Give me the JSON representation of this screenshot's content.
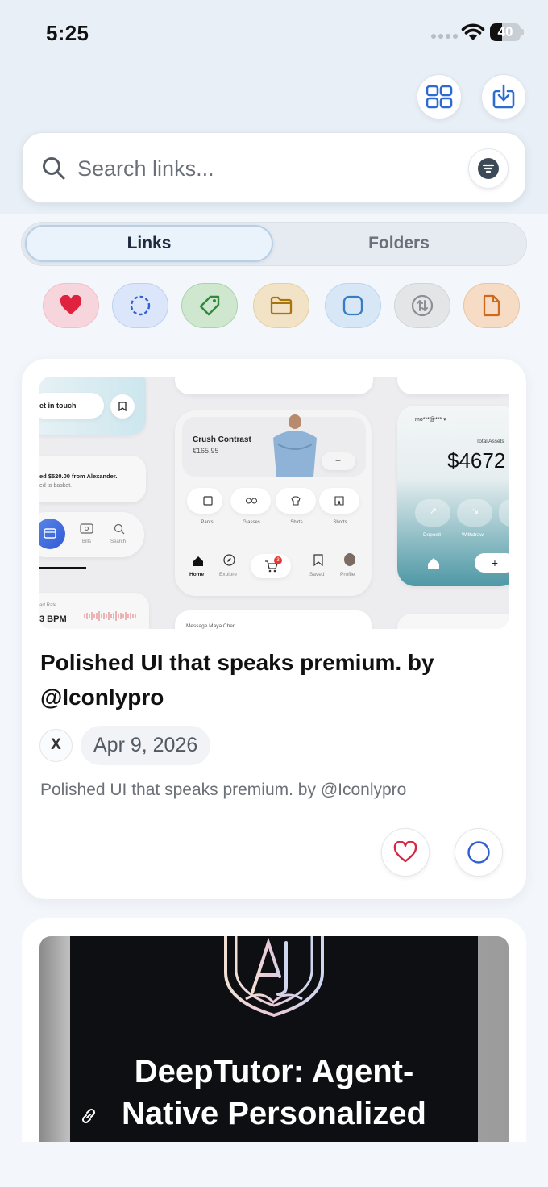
{
  "status_bar": {
    "time": "5:25",
    "battery_level": "40"
  },
  "toolbar": {
    "grid_icon": "grid-icon",
    "import_icon": "download-tray-icon"
  },
  "search": {
    "placeholder": "Search links...",
    "filter_icon": "filter-lines-icon"
  },
  "tabs": [
    {
      "label": "Links",
      "active": true
    },
    {
      "label": "Folders",
      "active": false
    }
  ],
  "filter_chips": [
    {
      "icon": "heart-icon",
      "color": "#f7d5dc",
      "accent": "#e0223f"
    },
    {
      "icon": "dashed-circle-icon",
      "color": "#dbe6fa",
      "accent": "#2f5fd0"
    },
    {
      "icon": "tag-icon",
      "color": "#cfe7cf",
      "accent": "#2f8a3b"
    },
    {
      "icon": "folder-icon",
      "color": "#f2e3c7",
      "accent": "#a87410"
    },
    {
      "icon": "square-icon",
      "color": "#d7e7f6",
      "accent": "#3a7cc2"
    },
    {
      "icon": "sort-arrows-icon",
      "color": "#e4e5e7",
      "accent": "#8a8f96"
    },
    {
      "icon": "document-icon",
      "color": "#f6dcc4",
      "accent": "#d0691c"
    }
  ],
  "cards": [
    {
      "title": "Polished UI that speaks premium. by @Iconlypro",
      "source_badge": "X",
      "date": "Apr 9, 2026",
      "description": "Polished UI that speaks premium. by @Iconlypro",
      "thumb": {
        "get_in_touch": "et in touch",
        "payment_line1": "ed $520.00 from Alexander.",
        "payment_line2": "ed to basket.",
        "bills": "Bills",
        "search": "Search",
        "heart_rate": "art Rate",
        "bpm": "3 BPM",
        "product_name": "Crush Contrast",
        "product_price": "€165,95",
        "cats": [
          "Pants",
          "Glasses",
          "Shirts",
          "Shorts"
        ],
        "nav": [
          "Home",
          "Explore",
          "Saved",
          "Profile"
        ],
        "cart_count": "3",
        "account_mask": "mo***@*** ▾",
        "total_assets_label": "Total Assets",
        "total_assets": "$4672",
        "deposit": "Deposit",
        "withdraw": "Withdraw",
        "message": "Message Maya Chen"
      }
    },
    {
      "thumb_title_line1": "DeepTutor: Agent-",
      "thumb_title_line2": "Native Personalized"
    }
  ]
}
